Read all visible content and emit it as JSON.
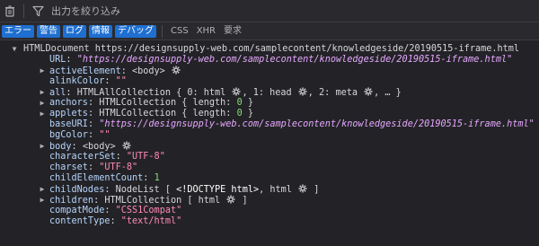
{
  "toolbar": {
    "filter_placeholder": "出力を絞り込み",
    "trash_icon": "trash-icon",
    "filter_icon": "funnel-icon"
  },
  "filters": {
    "chips": [
      {
        "label": "エラー",
        "active": true
      },
      {
        "label": "警告",
        "active": true
      },
      {
        "label": "ログ",
        "active": true
      },
      {
        "label": "情報",
        "active": true
      },
      {
        "label": "デバッグ",
        "active": true
      }
    ],
    "extra": [
      {
        "label": "CSS",
        "active": false
      },
      {
        "label": "XHR",
        "active": false
      },
      {
        "label": "要求",
        "active": false
      }
    ]
  },
  "console": {
    "header_object": "HTMLDocument",
    "header_url": "https://designsupply-web.com/samplecontent/knowledgeside/20190515-iframe.html",
    "rows": [
      {
        "key": "URL",
        "sep": ": ",
        "value": "\"https://designsupply-web.com/samplecontent/knowledgeside/20190515-iframe.html\""
      },
      {
        "key": "activeElement",
        "sep": ": ",
        "value": "<body>"
      },
      {
        "key": "alinkColor",
        "sep": ": ",
        "value": "\"\""
      },
      {
        "key": "all",
        "sep": ": ",
        "value": "HTMLAllCollection { 0: html",
        "v2": ", 1: head",
        "v3": ", 2: meta",
        "v4": ", … }"
      },
      {
        "key": "anchors",
        "sep": ": ",
        "value": "HTMLCollection { length: ",
        "num": "0",
        "end": " }"
      },
      {
        "key": "applets",
        "sep": ": ",
        "value": "HTMLCollection { length: ",
        "num": "0",
        "end": " }"
      },
      {
        "key": "baseURI",
        "sep": ": ",
        "value": "\"https://designsupply-web.com/samplecontent/knowledgeside/20190515-iframe.html\""
      },
      {
        "key": "bgColor",
        "sep": ": ",
        "value": "\"\""
      },
      {
        "key": "body",
        "sep": ": ",
        "value": "<body>"
      },
      {
        "key": "characterSet",
        "sep": ": ",
        "value": "\"UTF-8\""
      },
      {
        "key": "charset",
        "sep": ": ",
        "value": "\"UTF-8\""
      },
      {
        "key": "childElementCount",
        "sep": ": ",
        "value": "1"
      },
      {
        "key": "childNodes",
        "sep": ": ",
        "value": "NodeList [ ",
        "v2": "<!DOCTYPE html>",
        "v3": ", html",
        "v4": " ]"
      },
      {
        "key": "children",
        "sep": ": ",
        "value": "HTMLCollection [ html",
        "v4": " ]"
      },
      {
        "key": "compatMode",
        "sep": ": ",
        "value": "\"CSS1Compat\""
      },
      {
        "key": "contentType",
        "sep": ": ",
        "value": "\"text/html\""
      }
    ]
  }
}
